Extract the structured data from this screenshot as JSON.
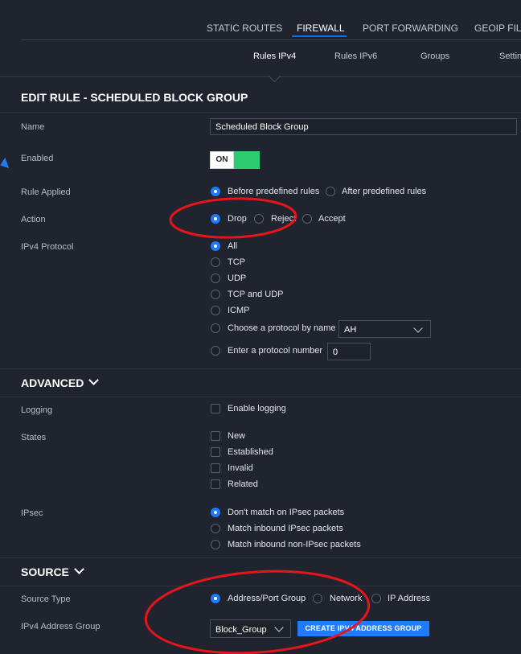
{
  "top_tabs": [
    "STATIC ROUTES",
    "FIREWALL",
    "PORT FORWARDING",
    "GEOIP FILT"
  ],
  "sub_tabs": [
    "Rules IPv4",
    "Rules IPv6",
    "Groups",
    "Settin"
  ],
  "page_title": "EDIT RULE - SCHEDULED BLOCK GROUP",
  "form": {
    "name_label": "Name",
    "name_value": "Scheduled Block Group",
    "enabled_label": "Enabled",
    "enabled_state": "ON",
    "rule_applied_label": "Rule Applied",
    "rule_applied_options": [
      "Before predefined rules",
      "After predefined rules"
    ],
    "action_label": "Action",
    "action_options": [
      "Drop",
      "Reject",
      "Accept"
    ],
    "protocol_label": "IPv4 Protocol",
    "protocol_options": [
      "All",
      "TCP",
      "UDP",
      "TCP and UDP",
      "ICMP",
      "Choose a protocol by name",
      "Enter a protocol number"
    ],
    "protocol_name_value": "AH",
    "protocol_number_value": "0"
  },
  "advanced": {
    "title": "ADVANCED",
    "logging_label": "Logging",
    "logging_option": "Enable logging",
    "states_label": "States",
    "states_options": [
      "New",
      "Established",
      "Invalid",
      "Related"
    ],
    "ipsec_label": "IPsec",
    "ipsec_options": [
      "Don't match on IPsec packets",
      "Match inbound IPsec packets",
      "Match inbound non-IPsec packets"
    ]
  },
  "source": {
    "title": "SOURCE",
    "type_label": "Source Type",
    "type_options": [
      "Address/Port Group",
      "Network",
      "IP Address"
    ],
    "group_label": "IPv4 Address Group",
    "group_value": "Block_Group",
    "create_button": "CREATE IPV4 ADDRESS GROUP"
  },
  "colors": {
    "accent": "#1f7bff",
    "toggle_on": "#2ecc71",
    "annotation": "#e8141c",
    "background": "#20242f"
  }
}
